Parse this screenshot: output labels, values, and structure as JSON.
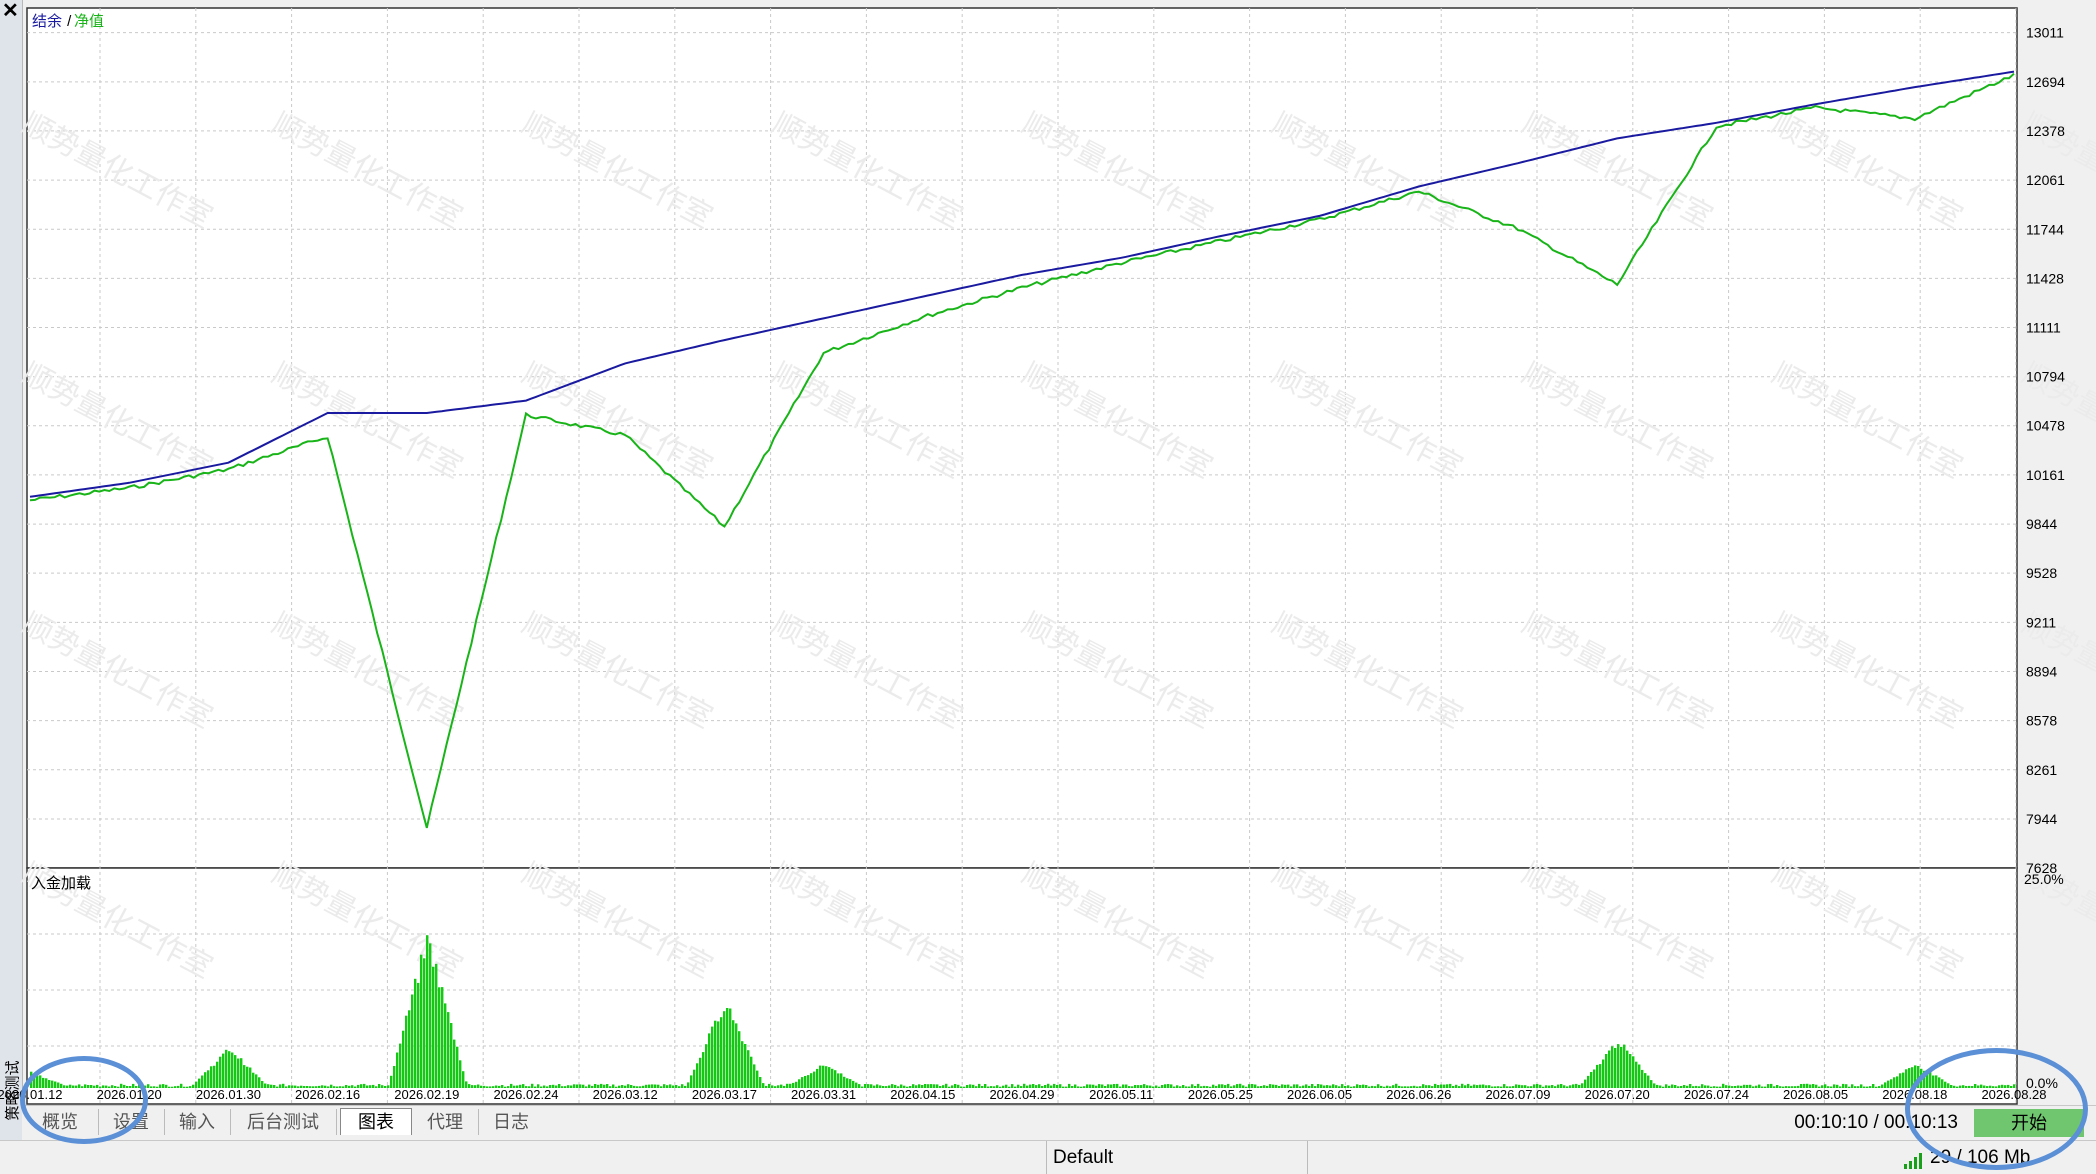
{
  "window": {
    "close_glyph": "✕",
    "side_title": "策略测试"
  },
  "chart": {
    "legend_balance": "结余",
    "legend_sep": " / ",
    "legend_equity": "净值",
    "sub_label": "入金加载",
    "y_ticks": [
      "13011",
      "12694",
      "12378",
      "12061",
      "11744",
      "11428",
      "11111",
      "10794",
      "10478",
      "10161",
      "9844",
      "9528",
      "9211",
      "8894",
      "8578",
      "8261",
      "7944",
      "7628"
    ],
    "sub_ticks": [
      "25.0%",
      "0.0%"
    ],
    "dates": [
      "2026.01.12",
      "2026.01.20",
      "2026.01.30",
      "2026.02.16",
      "2026.02.19",
      "2026.02.24",
      "2026.03.12",
      "2026.03.17",
      "2026.03.31",
      "2026.04.15",
      "2026.04.29",
      "2026.05.11",
      "2026.05.25",
      "2026.06.05",
      "2026.06.26",
      "2026.07.09",
      "2026.07.20",
      "2026.07.24",
      "2026.08.05",
      "2026.08.18",
      "2026.08.28"
    ],
    "watermark": "顺势量化工作室",
    "colors": {
      "balance": "#1a1aa0",
      "equity": "#18b418",
      "load": "#14c814",
      "grid": "#c9c9c9"
    }
  },
  "chart_data": {
    "type": "line",
    "title": "",
    "ylabel": "",
    "ylim": [
      7628,
      13170
    ],
    "x": [
      "2026.01.12",
      "2026.01.20",
      "2026.01.30",
      "2026.02.16",
      "2026.02.19",
      "2026.02.24",
      "2026.03.12",
      "2026.03.17",
      "2026.03.31",
      "2026.04.15",
      "2026.04.29",
      "2026.05.11",
      "2026.05.25",
      "2026.06.05",
      "2026.06.26",
      "2026.07.09",
      "2026.07.20",
      "2026.07.24",
      "2026.08.05",
      "2026.08.18",
      "2026.08.28"
    ],
    "series": [
      {
        "name": "结余",
        "values": [
          10020,
          10110,
          10240,
          10560,
          10560,
          10640,
          10880,
          11030,
          11170,
          11310,
          11450,
          11560,
          11700,
          11830,
          12020,
          12170,
          12330,
          12430,
          12550,
          12660,
          12760
        ]
      },
      {
        "name": "净值",
        "values": [
          10010,
          10090,
          10210,
          10420,
          7900,
          10560,
          10430,
          9840,
          10960,
          11190,
          11380,
          11540,
          11680,
          11820,
          12000,
          11760,
          11400,
          12420,
          12540,
          12470,
          12750
        ]
      }
    ],
    "subchart": {
      "label": "入金加载",
      "ylim": [
        0,
        25
      ],
      "unit": "%",
      "peaks": [
        {
          "x": "2026.01.12",
          "value": 2
        },
        {
          "x": "2026.01.30",
          "value": 5
        },
        {
          "x": "2026.02.19",
          "value": 19
        },
        {
          "x": "2026.03.17",
          "value": 11
        },
        {
          "x": "2026.03.31",
          "value": 3
        },
        {
          "x": "2026.07.20",
          "value": 6
        },
        {
          "x": "2026.08.18",
          "value": 3
        }
      ]
    }
  },
  "tabs": [
    {
      "label": "概览"
    },
    {
      "label": "设置"
    },
    {
      "label": "输入"
    },
    {
      "label": "后台测试"
    },
    {
      "label": "图表",
      "active": true
    },
    {
      "label": "代理"
    },
    {
      "label": "日志"
    }
  ],
  "timer": "00:10:10 / 00:10:13",
  "start_button": "开始",
  "status": {
    "profile": "Default",
    "memory": "29 / 106 Mb"
  }
}
